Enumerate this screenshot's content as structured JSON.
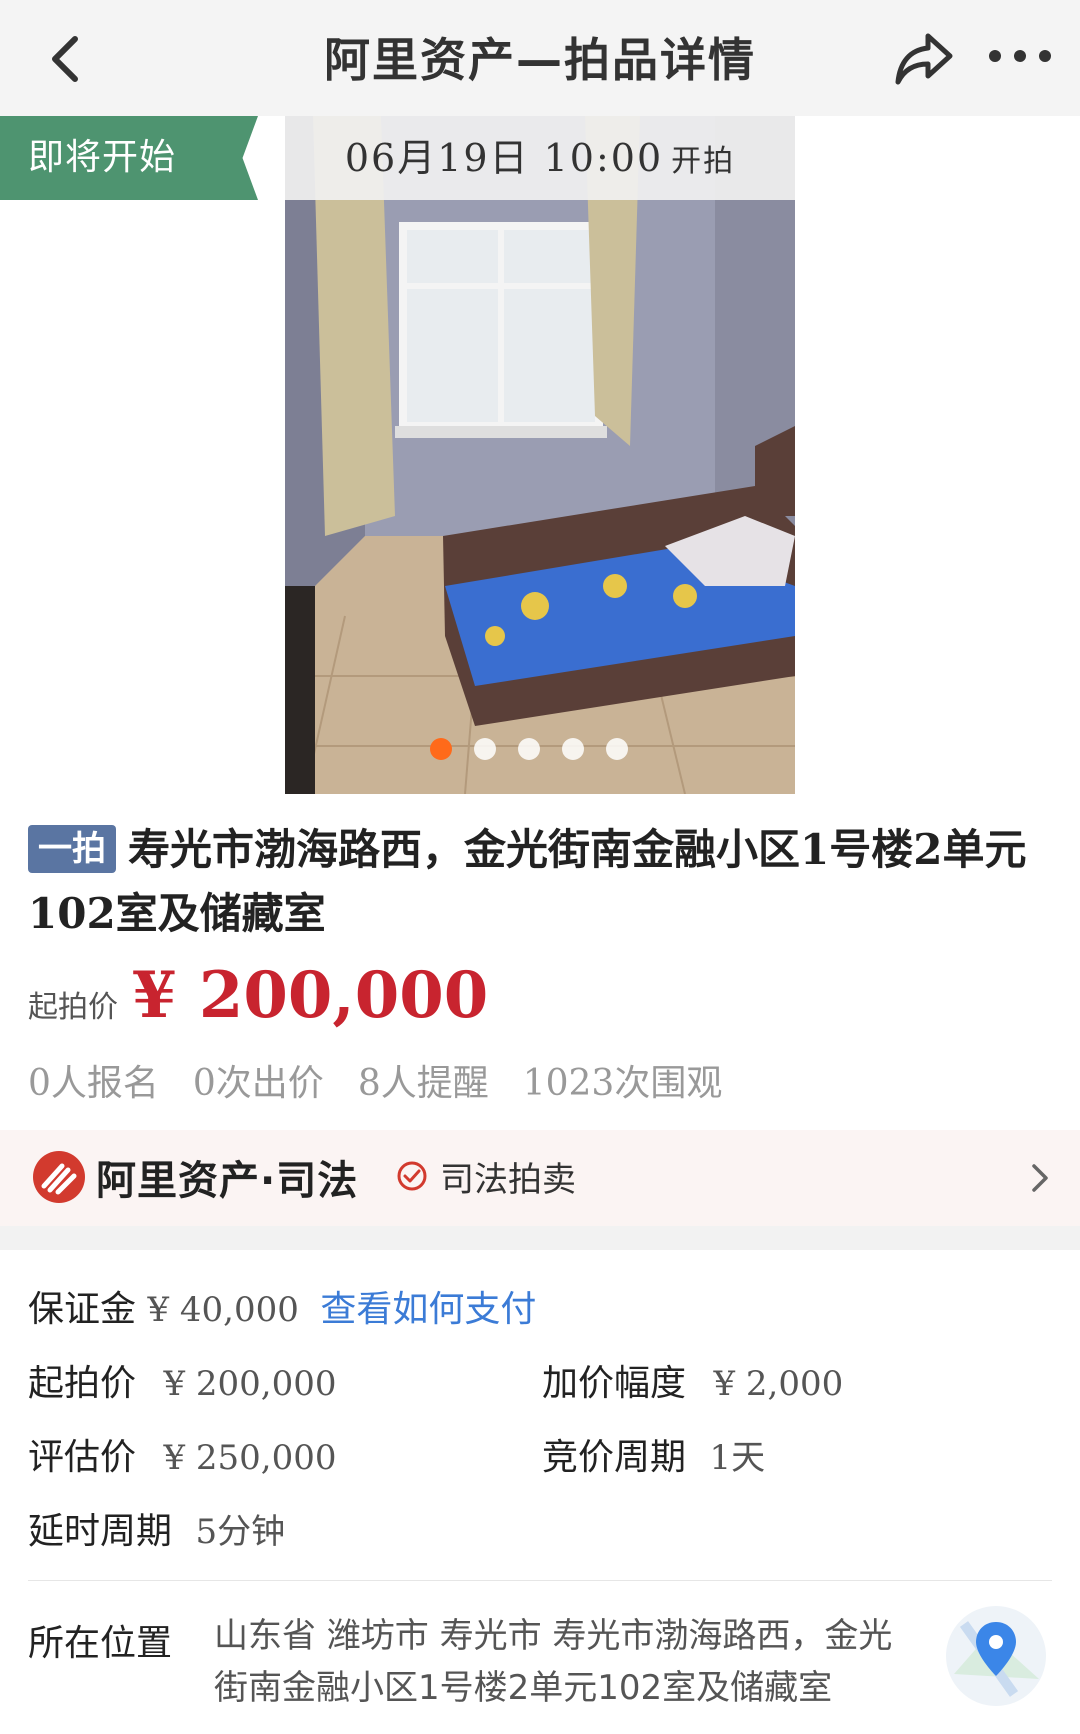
{
  "nav": {
    "title": "阿里资产—拍品详情"
  },
  "auction": {
    "status": "即将开始",
    "start_time": "06月19日 10:00",
    "start_suffix": "开拍",
    "round": "一拍",
    "title": "寿光市渤海路西，金光街南金融小区1号楼2单元102室及储藏室",
    "price_label": "起拍价",
    "price": "¥ 200,000",
    "gallery": {
      "image_count": 5,
      "active_index": 0
    },
    "stats": [
      "0人报名",
      "0次出价",
      "8人提醒",
      "1023次围观"
    ]
  },
  "banner": {
    "brand": "阿里资产·司法",
    "label": "司法拍卖"
  },
  "details": {
    "deposit_label": "保证金",
    "deposit_value": "¥ 40,000",
    "deposit_link": "查看如何支付",
    "start_price_label": "起拍价",
    "start_price_value": "¥ 200,000",
    "increment_label": "加价幅度",
    "increment_value": "¥ 2,000",
    "appraisal_label": "评估价",
    "appraisal_value": "¥ 250,000",
    "cycle_label": "竞价周期",
    "cycle_value": "1天",
    "delay_label": "延时周期",
    "delay_value": "5分钟",
    "location_label": "所在位置",
    "location_value": "山东省 潍坊市 寿光市 寿光市渤海路西，金光街南金融小区1号楼2单元102室及储藏室"
  },
  "colors": {
    "status_green": "#4e9470",
    "price_red": "#c8242f",
    "link_blue": "#3b7bd6",
    "dot_active": "#ff6a1a",
    "round_badge": "#5a75a2"
  },
  "icons": [
    "back-arrow-icon",
    "share-icon",
    "more-icon",
    "brand-logo-icon",
    "check-circle-icon",
    "chevron-right-icon",
    "map-pin-icon"
  ]
}
